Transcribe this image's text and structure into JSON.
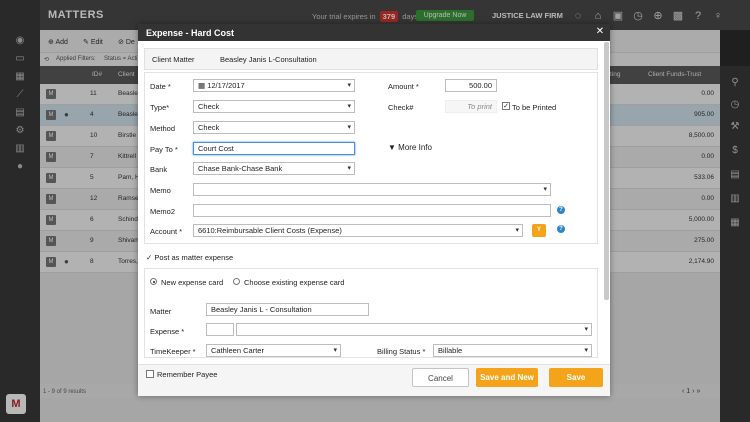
{
  "app": {
    "title": "MATTERS",
    "trial_prefix": "Your trial expires in",
    "trial_days": "379",
    "trial_suffix": "days.",
    "upgrade_label": "Upgrade Now",
    "firm_name": "JUSTICE LAW FIRM"
  },
  "toolbar": {
    "add_label": "Add",
    "edit_label": "Edit",
    "delete_label": "De"
  },
  "filters": {
    "applied_label": "Applied Filters:",
    "status_label": "Status = Acti"
  },
  "table": {
    "col_id": "ID#",
    "col_client": "Client",
    "col_ting": "ting",
    "col_funds": "Client Funds-Trust",
    "rows": [
      {
        "id": "11",
        "client": "Beasle",
        "funds": "0.00"
      },
      {
        "id": "4",
        "client": "Beasle",
        "funds": "905.00"
      },
      {
        "id": "10",
        "client": "Birstle",
        "funds": "8,500.00"
      },
      {
        "id": "7",
        "client": "Kittrell",
        "funds": "0.00"
      },
      {
        "id": "5",
        "client": "Pam, H",
        "funds": "533.06"
      },
      {
        "id": "12",
        "client": "Ramse",
        "funds": "0.00"
      },
      {
        "id": "6",
        "client": "Schind",
        "funds": "5,000.00"
      },
      {
        "id": "9",
        "client": "Shivam",
        "funds": "275.00"
      },
      {
        "id": "8",
        "client": "Torres,",
        "funds": "2,174.90"
      }
    ],
    "pager_text": "1 - 9 of 9 results",
    "page_number": "1"
  },
  "modal": {
    "title": "Expense - Hard Cost",
    "client_matter_label": "Client Matter",
    "client_matter_value": "Beasley Janis L-Consultation",
    "date_label": "Date *",
    "date_value": "12/17/2017",
    "amount_label": "Amount *",
    "amount_value": "500.00",
    "type_label": "Type*",
    "type_value": "Check",
    "check_label": "Check#",
    "check_placeholder": "To print",
    "to_be_printed_label": "To be Printed",
    "method_label": "Method",
    "method_value": "Check",
    "payto_label": "Pay To *",
    "payto_value": "Court Cost",
    "more_info_label": "More Info",
    "bank_label": "Bank",
    "bank_value": "Chase Bank-Chase Bank",
    "memo_label": "Memo",
    "memo_value": "",
    "memo2_label": "Memo2",
    "memo2_value": "",
    "account_label": "Account *",
    "account_value": "6610:Reimbursable Client Costs (Expense)",
    "account_btn": "Y",
    "post_label": "Post as matter expense",
    "new_card_label": "New expense card",
    "existing_card_label": "Choose existing expense card",
    "matter_label": "Matter",
    "matter_value": "Beasley Janis L - Consultation",
    "expense_label": "Expense *",
    "timekeeper_label": "TimeKeeper *",
    "timekeeper_value": "Cathleen Carter",
    "billing_label": "Billing Status *",
    "billing_value": "Billable",
    "remember_label": "Remember Payee",
    "cancel_label": "Cancel",
    "save_new_label": "Save and New",
    "save_label": "Save"
  },
  "colors": {
    "accent": "#f5a31a",
    "header_dark": "#333333",
    "upgrade_green": "#3c9a3f",
    "trial_red": "#d9342b"
  }
}
